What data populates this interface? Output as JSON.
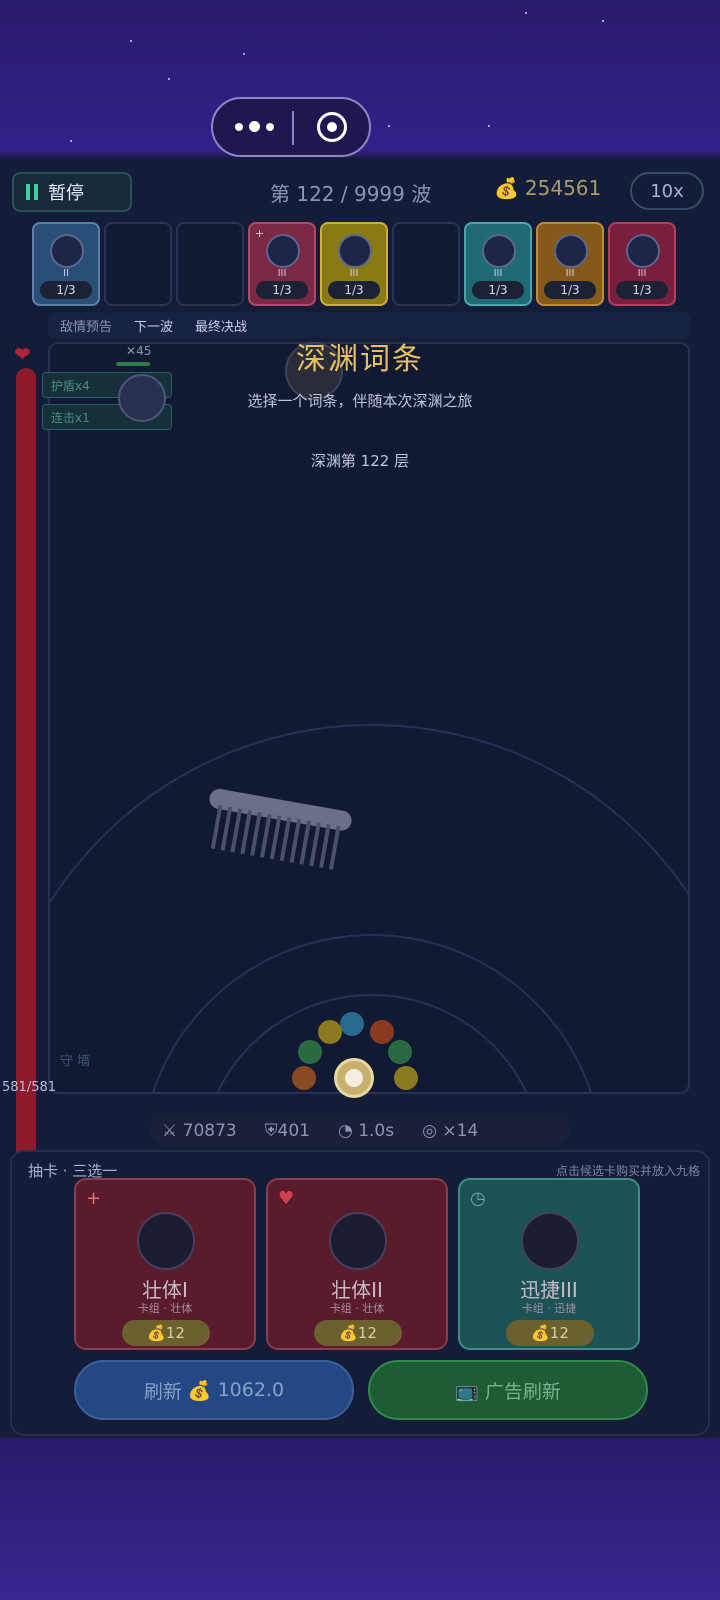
{
  "capsule": {
    "more_icon": "more-dots-icon",
    "close_icon": "target-icon"
  },
  "topbar": {
    "pause_label": "暂停",
    "wave_text": "第 122 / 9999 波",
    "gold_icon": "money-bag-icon",
    "gold_value": "254561",
    "speed_label": "10x"
  },
  "slots": [
    {
      "level": "II",
      "count": "1/3",
      "color": "blue",
      "tag": ""
    },
    {
      "level": "",
      "count": "",
      "color": "empty",
      "tag": ""
    },
    {
      "level": "",
      "count": "",
      "color": "empty",
      "tag": ""
    },
    {
      "level": "III",
      "count": "1/3",
      "color": "red",
      "tag": "+"
    },
    {
      "level": "III",
      "count": "1/3",
      "color": "yellow",
      "tag": ""
    },
    {
      "level": "",
      "count": "",
      "color": "empty",
      "tag": ""
    },
    {
      "level": "III",
      "count": "1/3",
      "color": "cyan",
      "tag": ""
    },
    {
      "level": "III",
      "count": "1/3",
      "color": "orange",
      "tag": ""
    },
    {
      "level": "III",
      "count": "1/3",
      "color": "pink",
      "tag": ""
    }
  ],
  "infobar": {
    "label1": "敌情预告",
    "label2": "下一波",
    "label3": "最终决战"
  },
  "hp": {
    "text": "581/581",
    "fraction": 1.0
  },
  "buffs": [
    "护盾x4",
    "连击x1"
  ],
  "enemy": {
    "attack": "45"
  },
  "guard_label": "守 墙",
  "abyss": {
    "title": "深渊词条",
    "subtitle": "选择一个词条，伴随本次深渊之旅",
    "floor": "深渊第 122 层"
  },
  "stats": {
    "attack": "70873",
    "defense": "401",
    "interval": "1.0s",
    "multi": "×14"
  },
  "draw": {
    "title": "抽卡 · 三选一",
    "hint": "点击候选卡购买并放入九格",
    "cards": [
      {
        "name": "壮体I",
        "meta": "卡组 · 壮体",
        "price": "12",
        "badge": "+",
        "color": "red"
      },
      {
        "name": "壮体II",
        "meta": "卡组 · 壮体",
        "price": "12",
        "badge": "♥",
        "color": "red"
      },
      {
        "name": "迅捷III",
        "meta": "卡组 · 迅捷",
        "price": "12",
        "badge": "◷",
        "color": "cyan"
      }
    ],
    "refresh_label": "刷新",
    "refresh_cost": "1062.0",
    "ad_refresh_label": "广告刷新"
  }
}
